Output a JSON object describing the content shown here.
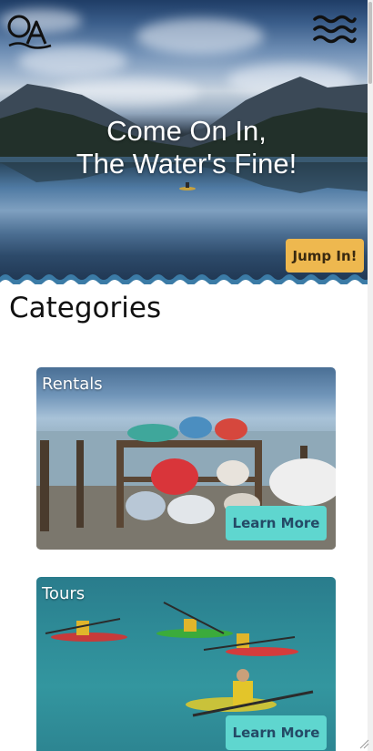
{
  "header": {
    "logo_icon": "oa-logo-icon",
    "menu_icon": "wave-menu-icon"
  },
  "hero": {
    "title_line1": "Come On In,",
    "title_line2": "The Water's Fine!",
    "cta_label": "Jump In!"
  },
  "categories": {
    "heading": "Categories",
    "cards": [
      {
        "label": "Rentals",
        "button_label": "Learn More"
      },
      {
        "label": "Tours",
        "button_label": "Learn More"
      }
    ]
  },
  "colors": {
    "cta_bg": "#eeb84f",
    "learn_more_bg": "#5fd6cf",
    "learn_more_text": "#244a66",
    "wave_divider": "#3b7ba6"
  }
}
